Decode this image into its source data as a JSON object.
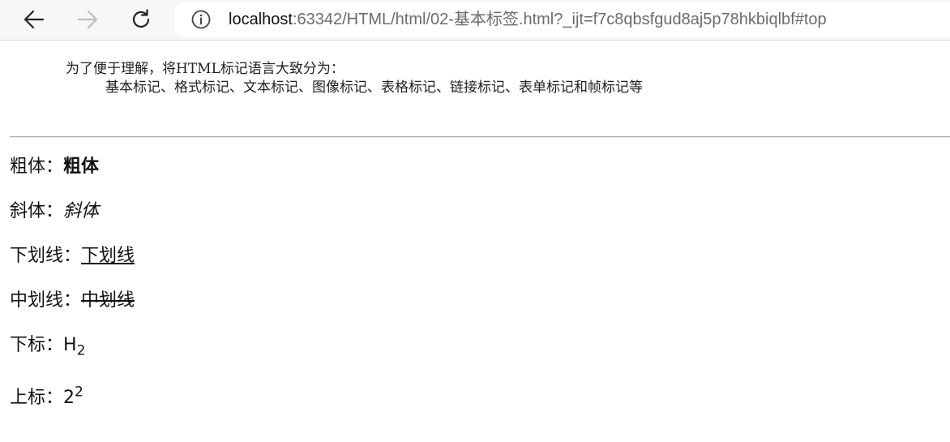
{
  "browser": {
    "url_host": "localhost",
    "url_rest": ":63342/HTML/html/02-基本标签.html?_ijt=f7c8qbsfgud8aj5p78hkbiqlbf#top",
    "icons": {
      "back": "arrow-left-icon",
      "forward": "arrow-right-icon",
      "reload": "reload-icon",
      "info": "info-icon"
    }
  },
  "page": {
    "intro": "为了便于理解，将HTML标记语言大致分为：",
    "intro_list": "基本标记、格式标记、文本标记、图像标记、表格标记、链接标记、表单标记和帧标记等",
    "rows": {
      "bold": {
        "label": "粗体：",
        "value": "粗体"
      },
      "italic": {
        "label": "斜体：",
        "value": "斜体"
      },
      "underline": {
        "label": "下划线：",
        "value": "下划线"
      },
      "strike": {
        "label": "中划线：",
        "value": "中划线"
      },
      "sub": {
        "label": "下标：",
        "base": "H",
        "script": "2"
      },
      "sup": {
        "label": "上标：",
        "base": "2",
        "script": "2"
      }
    }
  }
}
